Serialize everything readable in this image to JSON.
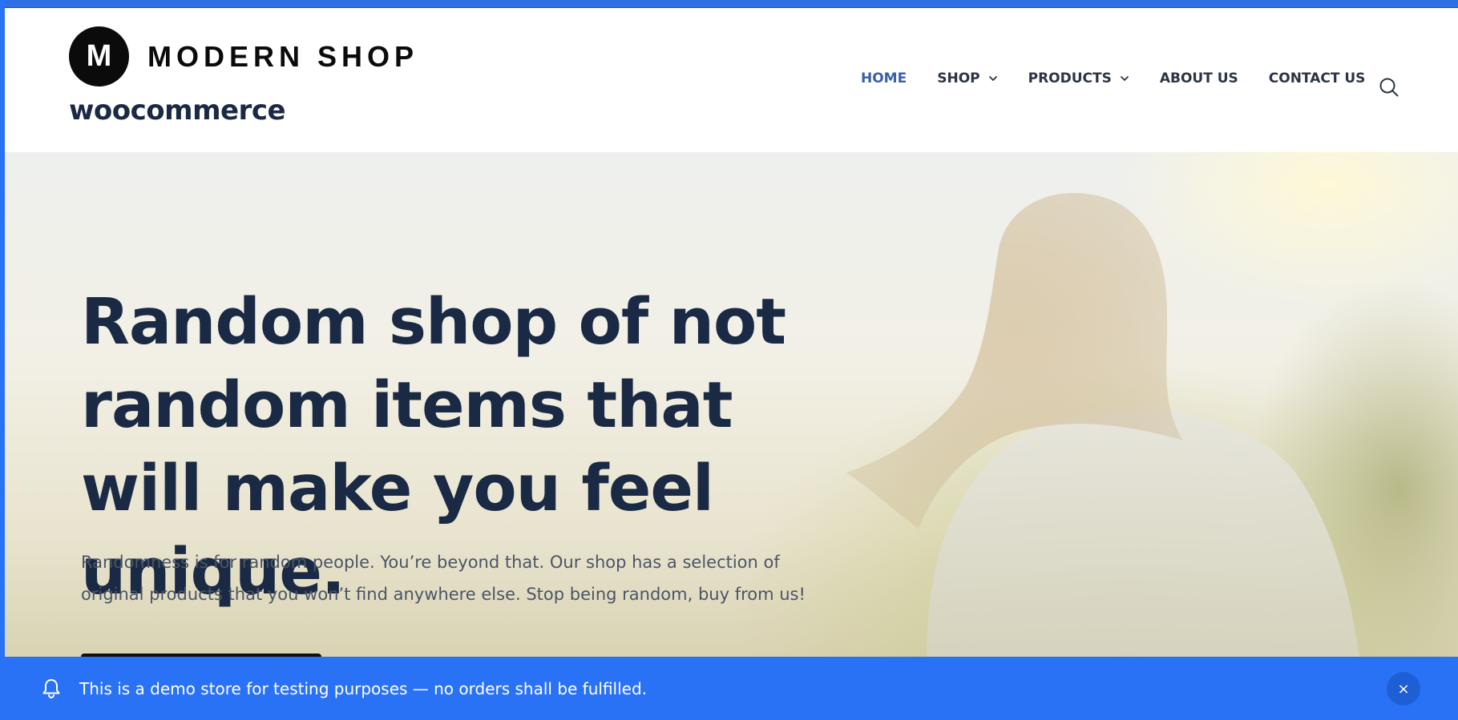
{
  "header": {
    "logo_letter": "M",
    "logo_text": "MODERN SHOP",
    "site_title": "woocommerce",
    "nav": [
      {
        "label": "HOME",
        "active": true,
        "has_dropdown": false
      },
      {
        "label": "SHOP",
        "active": false,
        "has_dropdown": true
      },
      {
        "label": "PRODUCTS",
        "active": false,
        "has_dropdown": true
      },
      {
        "label": "ABOUT US",
        "active": false,
        "has_dropdown": false
      },
      {
        "label": "CONTACT US",
        "active": false,
        "has_dropdown": false
      }
    ],
    "search_icon": "search-icon"
  },
  "hero": {
    "title": "Random shop of not random items that will make you feel unique.",
    "text": "Randomness is for random people. You’re beyond that. Our shop has a selection of original products that you won’t find anywhere else. Stop being random, buy from us!"
  },
  "notice": {
    "icon": "bell-icon",
    "text": "This is a demo store for testing purposes — no orders shall be fulfilled.",
    "dismiss_label": "×"
  },
  "colors": {
    "accent": "#2a72f5",
    "nav_active": "#3a5fa6",
    "heading": "#1b2a44",
    "logo_mark": "#0b0b0b"
  }
}
